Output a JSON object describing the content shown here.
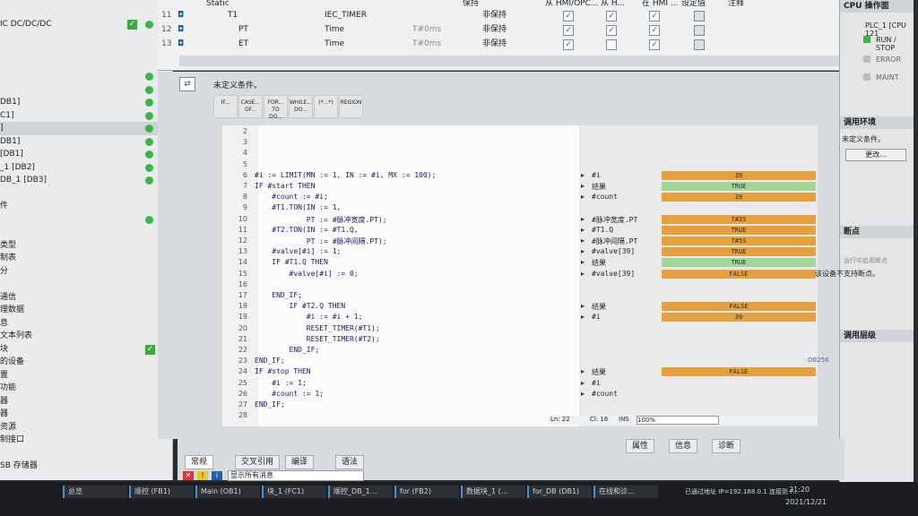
{
  "tree": {
    "items": [
      {
        "label": "IC DC/DC/DC",
        "status": "check-dot"
      },
      {
        "label": "",
        "status": ""
      },
      {
        "label": "",
        "status": ""
      },
      {
        "label": "",
        "status": ""
      },
      {
        "label": "",
        "status": "dot"
      },
      {
        "label": "",
        "status": "dot"
      },
      {
        "label": "DB1]",
        "status": "dot"
      },
      {
        "label": "C1]",
        "status": "dot"
      },
      {
        "label": "]",
        "status": "dot"
      },
      {
        "label": "DB1]",
        "status": "dot"
      },
      {
        "label": "[DB1]",
        "status": "dot"
      },
      {
        "label": "_1 [DB2]",
        "status": "dot"
      },
      {
        "label": "DB_1 [DB3]",
        "status": "dot"
      },
      {
        "label": "",
        "status": ""
      },
      {
        "label": "件",
        "status": ""
      },
      {
        "label": "",
        "status": "dot"
      },
      {
        "label": "",
        "status": ""
      },
      {
        "label": "类型",
        "status": ""
      },
      {
        "label": "制表",
        "status": ""
      },
      {
        "label": "分",
        "status": ""
      },
      {
        "label": "",
        "status": ""
      },
      {
        "label": "通信",
        "status": ""
      },
      {
        "label": "理数据",
        "status": ""
      },
      {
        "label": "息",
        "status": ""
      },
      {
        "label": "文本列表",
        "status": ""
      },
      {
        "label": "块",
        "status": "check"
      },
      {
        "label": "的设备",
        "status": ""
      },
      {
        "label": "置",
        "status": ""
      },
      {
        "label": "功能",
        "status": ""
      },
      {
        "label": "器",
        "status": ""
      },
      {
        "label": "器",
        "status": ""
      },
      {
        "label": "资源",
        "status": ""
      },
      {
        "label": "制接口",
        "status": ""
      },
      {
        "label": "",
        "status": ""
      },
      {
        "label": "SB 存储器",
        "status": ""
      }
    ],
    "bottom_label": "视图"
  },
  "iface": {
    "header": {
      "section": "Static",
      "retain": "保持",
      "hmi_opc": "从 HMI/OPC...",
      "hmi_h": "从 H...",
      "in_hmi": "在 HMI ...",
      "setpoint": "设定值",
      "comment": "注释"
    },
    "rows": [
      {
        "num": "11",
        "name": "T1",
        "type": "IEC_TIMER",
        "default": "",
        "retain": "非保持",
        "c1": true,
        "c2": true,
        "c3": true
      },
      {
        "num": "12",
        "name": "PT",
        "type": "Time",
        "default": "T#0ms",
        "retain": "非保持",
        "c1": true,
        "c2": true,
        "c3": true
      },
      {
        "num": "13",
        "name": "ET",
        "type": "Time",
        "default": "T#0ms",
        "retain": "非保持",
        "c1": true,
        "c2": false,
        "c3": true
      }
    ]
  },
  "editor": {
    "condition_text": "未定义条件。",
    "toolbar": [
      "IF...",
      "CASE... OF...",
      "FOR... TO DO...",
      "WHILE... DO...",
      "(*...*)",
      "REGION"
    ],
    "lines": [
      {
        "n": "2",
        "code": ""
      },
      {
        "n": "3",
        "code": ""
      },
      {
        "n": "4",
        "code": ""
      },
      {
        "n": "5",
        "code": ""
      },
      {
        "n": "6",
        "code": "#i := LIMIT(MN := 1, IN := #i, MX := 100);"
      },
      {
        "n": "7",
        "code": "IF #start THEN"
      },
      {
        "n": "8",
        "code": "    #count := #i;"
      },
      {
        "n": "9",
        "code": "    #T1.TON(IN := 1,"
      },
      {
        "n": "10",
        "code": "            PT := #脉冲宽度.PT);"
      },
      {
        "n": "11",
        "code": "    #T2.TON(IN := #T1.Q,"
      },
      {
        "n": "12",
        "code": "            PT := #脉冲间隔.PT);"
      },
      {
        "n": "13",
        "code": "    #valve[#i] := 1;"
      },
      {
        "n": "14",
        "code": "    IF #T1.Q THEN"
      },
      {
        "n": "15",
        "code": "        #valve[#i] := 0;"
      },
      {
        "n": "16",
        "code": ""
      },
      {
        "n": "17",
        "code": "    END_IF;"
      },
      {
        "n": "18",
        "code": "        IF #T2.Q THEN"
      },
      {
        "n": "19",
        "code": "            #i := #i + 1;"
      },
      {
        "n": "20",
        "code": "            RESET_TIMER(#T1);"
      },
      {
        "n": "21",
        "code": "            RESET_TIMER(#T2);"
      },
      {
        "n": "22",
        "code": "        END_IF;"
      },
      {
        "n": "23",
        "code": "END_IF;"
      },
      {
        "n": "24",
        "code": "IF #stop THEN"
      },
      {
        "n": "25",
        "code": "    #i := 1;"
      },
      {
        "n": "26",
        "code": "    #count := 1;"
      },
      {
        "n": "27",
        "code": "END_IF;"
      },
      {
        "n": "28",
        "code": ""
      }
    ],
    "monitor": [
      {
        "label": "#i",
        "value": "39",
        "color": "orange",
        "line": 6
      },
      {
        "label": "结果",
        "value": "TRUE",
        "color": "green",
        "line": 7
      },
      {
        "label": "#count",
        "value": "39",
        "color": "orange",
        "line": 8
      },
      {
        "label": "#脉冲宽度.PT",
        "value": "T#2S",
        "color": "orange",
        "line": 10
      },
      {
        "label": "#T1.Q",
        "value": "TRUE",
        "color": "orange",
        "line": 11
      },
      {
        "label": "#脉冲间隔.PT",
        "value": "T#5S",
        "color": "orange",
        "line": 12
      },
      {
        "label": "#valve[39]",
        "value": "TRUE",
        "color": "orange",
        "line": 13
      },
      {
        "label": "结果",
        "value": "TRUE",
        "color": "green",
        "line": 14
      },
      {
        "label": "#valve[39]",
        "value": "FALSE",
        "color": "orange",
        "line": 15
      },
      {
        "label": "结果",
        "value": "FALSE",
        "color": "orange",
        "line": 18
      },
      {
        "label": "#i",
        "value": "39",
        "color": "orange",
        "line": 19
      },
      {
        "label": "结果",
        "value": "FALSE",
        "color": "orange",
        "line": 24
      },
      {
        "label": "#i",
        "value": "",
        "color": "none",
        "line": 25
      },
      {
        "label": "#count",
        "value": "",
        "color": "none",
        "line": 26
      }
    ],
    "status": {
      "ln": "Ln: 22",
      "cl": "Cl: 16",
      "ins": "INS",
      "zoom": "100%"
    }
  },
  "bottom": {
    "right_tabs": [
      "属性",
      "信息",
      "诊断"
    ],
    "tabs": [
      "常规",
      "交叉引用",
      "编译",
      "语法"
    ],
    "filter": "显示所有消息"
  },
  "right": {
    "title": "CPU 操作面",
    "cpu": "PLC_1 [CPU 121",
    "leds": [
      "RUN / STOP",
      "ERROR",
      "MAINT"
    ],
    "debug_env": "调用环境",
    "debug_text": "未定义条件。",
    "change": "更改...",
    "breakpoints": "断点",
    "bp_run": "运行中启用断点",
    "bp_note": "该设备不支持断点。",
    "call_hier": "调用层级",
    "ob": "OB256"
  },
  "taskbar": {
    "items": [
      "总览",
      "顺控 (FB1)",
      "Main (OB1)",
      "块_1 (FC1)",
      "顺控_DB_1...",
      "for (FB2)",
      "数据块_1 (...",
      "for_DB (DB1)",
      "在线和诊..."
    ],
    "status": "已通过地址 IP=192.168.0.1 连接到 P...",
    "time": "21:20",
    "date": "2021/12/21"
  },
  "colors": {
    "orange": "#e6a13e",
    "green": "#9fd79c",
    "accent": "#3bb54a"
  }
}
